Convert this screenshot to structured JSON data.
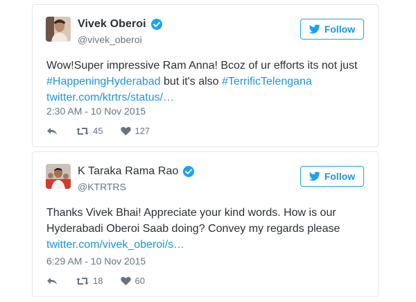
{
  "tweets": [
    {
      "author": {
        "name": "Vivek Oberoi",
        "handle": "@vivek_oberoi",
        "verified": true
      },
      "follow_label": "Follow",
      "text": {
        "line1": "Wow!Super impressive Ram Anna! Bcoz of ur efforts its not just",
        "hashtag1": "#HappeningHyderabad",
        "mid": " but it's also ",
        "hashtag2": "#TerrificTelengana",
        "link": "twitter.com/ktrtrs/status/…"
      },
      "timestamp": "2:30 AM - 10 Nov 2015",
      "retweets": "45",
      "likes": "127"
    },
    {
      "author": {
        "name": "K Taraka Rama Rao",
        "handle": "@KTRTRS",
        "verified": true
      },
      "follow_label": "Follow",
      "text": {
        "line1": "Thanks Vivek Bhai! Appreciate your kind words. How is our",
        "line2": "Hyderabadi Oberoi Saab doing? Convey my regards please",
        "link": "twitter.com/vivek_oberoi/s…"
      },
      "timestamp": "6:29 AM - 10 Nov 2015",
      "retweets": "18",
      "likes": "60"
    }
  ],
  "colors": {
    "accent": "#1da1f2",
    "link": "#1b95e0",
    "text": "#292f33",
    "muted": "#66757f",
    "border": "#e1e8ed"
  },
  "icons": [
    "verified-badge-icon",
    "twitter-bird-icon",
    "reply-icon",
    "retweet-icon",
    "heart-icon"
  ]
}
